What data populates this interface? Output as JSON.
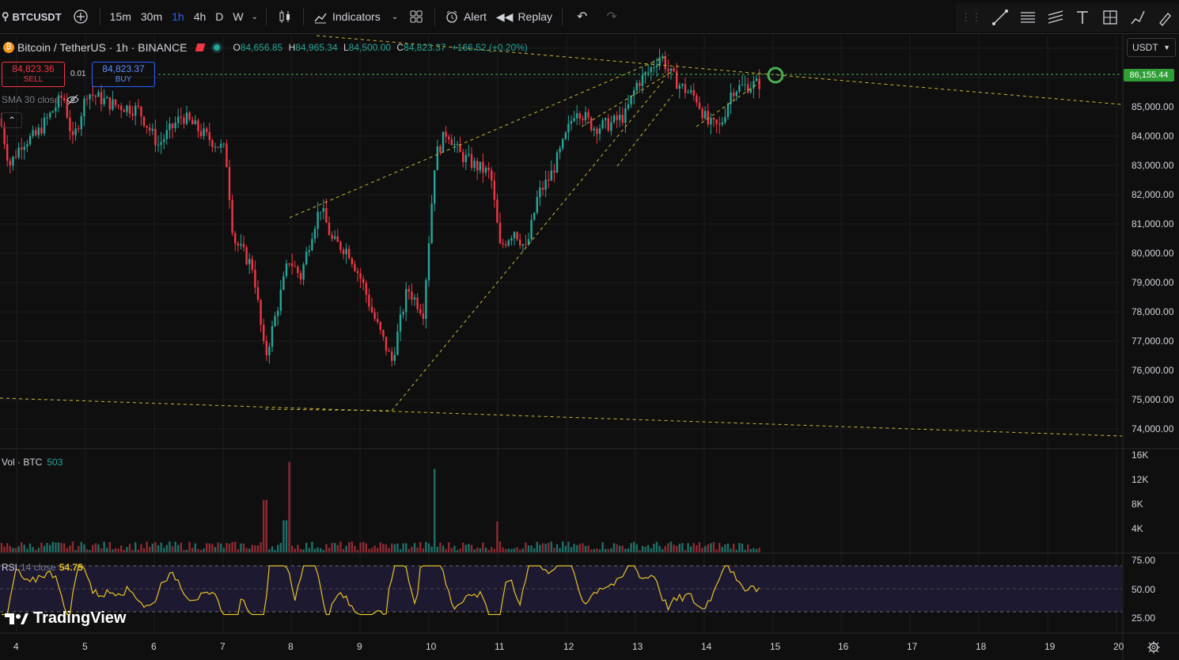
{
  "toolbar": {
    "symbol": "BTCUSDT",
    "timeframes": [
      "15m",
      "30m",
      "1h",
      "4h",
      "D",
      "W"
    ],
    "active_timeframe": "1h",
    "indicators_label": "Indicators",
    "alert_label": "Alert",
    "replay_label": "Replay"
  },
  "legend": {
    "pair": "Bitcoin / TetherUS · 1h · BINANCE",
    "open_label": "O",
    "open": "84,656.85",
    "high_label": "H",
    "high": "84,965.34",
    "low_label": "L",
    "low": "84,500.00",
    "close_label": "C",
    "close": "84,823.37",
    "change": "+166.52 (+0.20%)"
  },
  "trade": {
    "sell_price": "84,823.36",
    "sell_label": "SELL",
    "spread": "0.01",
    "buy_price": "84,823.37",
    "buy_label": "BUY"
  },
  "sma_label": "SMA 30 close",
  "volume": {
    "label": "Vol · BTC",
    "value": "503"
  },
  "rsi": {
    "label": "RSI",
    "params": "14 close",
    "value": "54.75"
  },
  "currency": "USDT",
  "alert_price_tag": "86,155.44",
  "price_axis": [
    "85,000.00",
    "84,000.00",
    "83,000.00",
    "82,000.00",
    "81,000.00",
    "80,000.00",
    "79,000.00",
    "78,000.00",
    "77,000.00",
    "76,000.00",
    "75,000.00",
    "74,000.00"
  ],
  "volume_axis": [
    "16K",
    "12K",
    "8K",
    "4K"
  ],
  "rsi_axis": [
    "75.00",
    "50.00",
    "25.00"
  ],
  "time_axis": [
    "4",
    "5",
    "6",
    "7",
    "8",
    "9",
    "10",
    "11",
    "12",
    "13",
    "14",
    "15",
    "16",
    "17",
    "18",
    "19",
    "20"
  ],
  "logo": "TradingView",
  "colors": {
    "up": "#26a69a",
    "down": "#f23645",
    "accent": "#2962ff",
    "trend": "#c8b830",
    "alert": "#4caf50",
    "rsi": "#e6c229"
  }
}
